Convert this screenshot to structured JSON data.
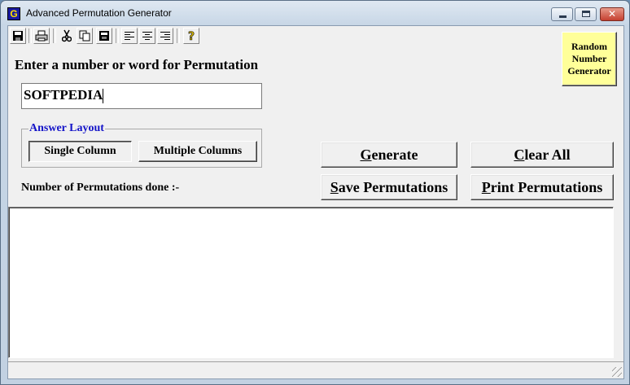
{
  "window": {
    "title": "Advanced Permutation Generator",
    "app_icon": "G"
  },
  "toolbar": {
    "icons": [
      "save-icon",
      "print-icon",
      "cut-icon",
      "copy-icon",
      "paste-icon",
      "align-left-icon",
      "align-center-icon",
      "align-right-icon",
      "help-icon"
    ]
  },
  "random_number_button": {
    "line1": "Random",
    "line2": "Number",
    "line3": "Generator",
    "color": "#ffff99"
  },
  "prompt": {
    "label": "Enter a number or word for Permutation",
    "value": "SOFTPEDIA"
  },
  "answer_layout": {
    "legend": "Answer Layout",
    "legend_color": "#1414c8",
    "single": "Single Column",
    "multiple": "Multiple Columns",
    "selected": "Single Column"
  },
  "buttons": {
    "generate": {
      "first": "G",
      "rest": "enerate"
    },
    "clear_all": {
      "first": "C",
      "rest": "lear All"
    },
    "save": {
      "first": "S",
      "rest": "ave Permutations"
    },
    "print": {
      "first": "P",
      "rest": "rint Permutations"
    }
  },
  "count_label": "Number of Permutations done :-"
}
